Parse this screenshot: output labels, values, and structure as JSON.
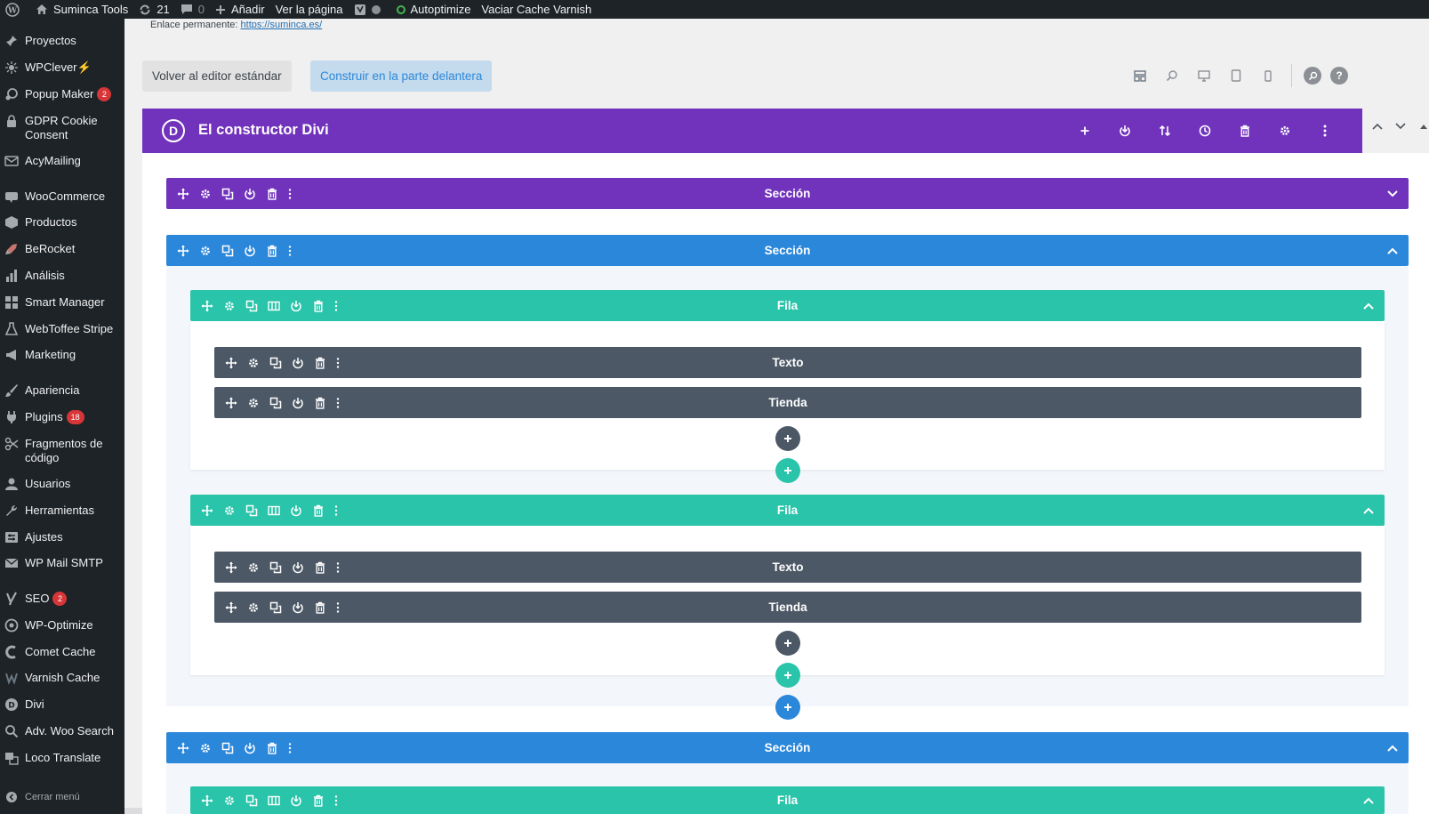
{
  "adminbar": {
    "site_name": "Suminca Tools",
    "updates_count": "21",
    "comments_count": "0",
    "add_label": "Añadir",
    "view_page_label": "Ver la página",
    "autoptimize_label": "Autoptimize",
    "varnish_label": "Vaciar Cache Varnish"
  },
  "sidebar": {
    "items": [
      {
        "label": "Proyectos",
        "icon": "pin-icon"
      },
      {
        "label": "WPClever",
        "icon": "wpclever-icon",
        "suffix": "⚡"
      },
      {
        "label": "Popup Maker",
        "icon": "popup-icon",
        "badge": "2"
      },
      {
        "label": "GDPR Cookie Consent",
        "icon": "lock-icon"
      },
      {
        "label": "AcyMailing",
        "icon": "acymailing-icon"
      },
      {
        "label": "WooCommerce",
        "icon": "woo-icon"
      },
      {
        "label": "Productos",
        "icon": "box-icon"
      },
      {
        "label": "BeRocket",
        "icon": "rocket-icon"
      },
      {
        "label": "Análisis",
        "icon": "chart-icon"
      },
      {
        "label": "Smart Manager",
        "icon": "grid-icon"
      },
      {
        "label": "WebToffee Stripe",
        "icon": "stripe-icon"
      },
      {
        "label": "Marketing",
        "icon": "megaphone-icon"
      },
      {
        "label": "Apariencia",
        "icon": "brush-icon"
      },
      {
        "label": "Plugins",
        "icon": "plug-icon",
        "badge": "18"
      },
      {
        "label": "Fragmentos de código",
        "icon": "scissors-icon"
      },
      {
        "label": "Usuarios",
        "icon": "user-icon"
      },
      {
        "label": "Herramientas",
        "icon": "wrench-icon"
      },
      {
        "label": "Ajustes",
        "icon": "settings-icon"
      },
      {
        "label": "WP Mail SMTP",
        "icon": "mail-icon"
      },
      {
        "label": "SEO",
        "icon": "yoast-icon",
        "badge": "2"
      },
      {
        "label": "WP-Optimize",
        "icon": "optimize-icon"
      },
      {
        "label": "Comet Cache",
        "icon": "comet-icon"
      },
      {
        "label": "Varnish Cache",
        "icon": "varnish-icon"
      },
      {
        "label": "Divi",
        "icon": "divi-icon"
      },
      {
        "label": "Adv. Woo Search",
        "icon": "search-icon"
      },
      {
        "label": "Loco Translate",
        "icon": "translate-icon"
      }
    ],
    "collapse_label": "Cerrar menú"
  },
  "permalink": {
    "label": "Enlace permanente:",
    "url": "https://suminca.es/"
  },
  "buttons": {
    "standard_editor": "Volver al editor estándar",
    "front_builder": "Construir en la parte delantera"
  },
  "divi": {
    "logo_letter": "D",
    "title": "El constructor Divi"
  },
  "builder": {
    "section_label": "Sección",
    "row_label": "Fila",
    "module_text": "Texto",
    "module_shop": "Tienda"
  },
  "colors": {
    "admin_dark": "#1d2327",
    "divi_purple": "#7132bc",
    "section_blue": "#2b87da",
    "row_green": "#29c4a9",
    "module_dark": "#4c5866",
    "badge_red": "#d63638"
  }
}
